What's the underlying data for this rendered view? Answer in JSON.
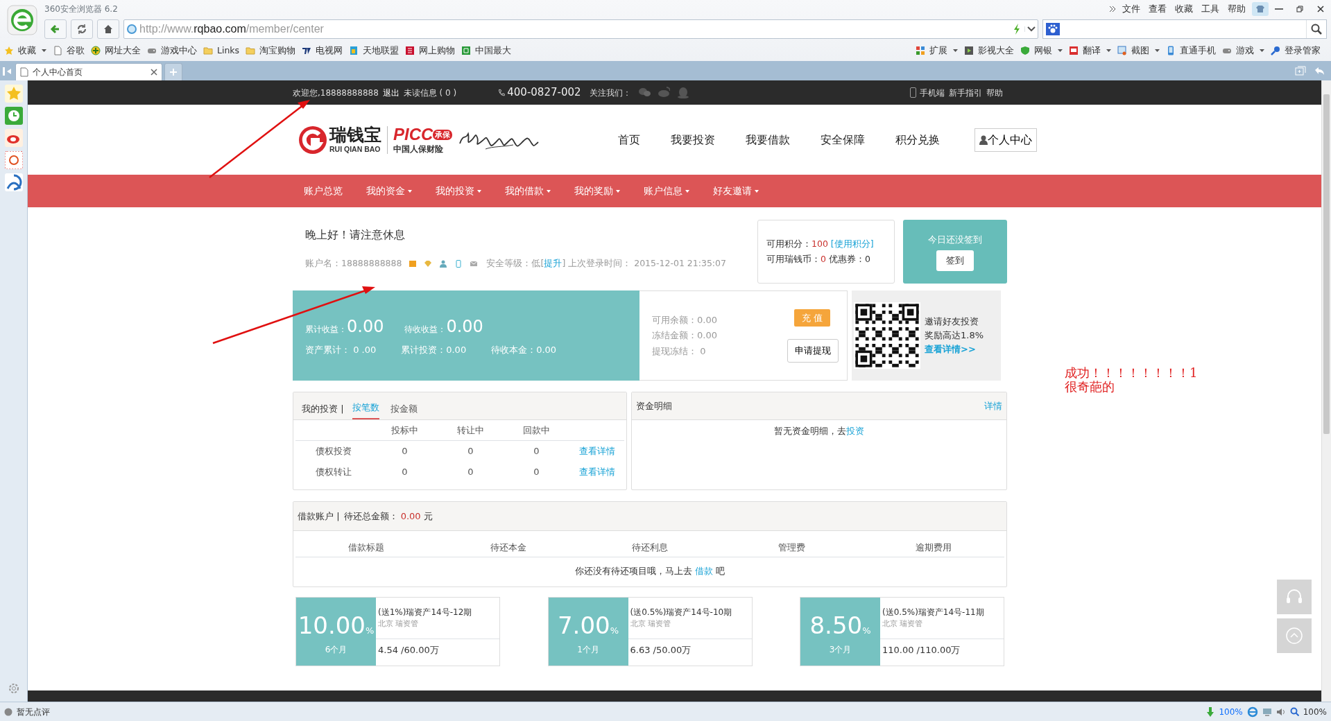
{
  "browser": {
    "title": "360安全浏览器 6.2",
    "menu": [
      "文件",
      "查看",
      "收藏",
      "工具",
      "帮助"
    ],
    "url": {
      "scheme": "http://www.",
      "domain": "rqbao.com",
      "path": "/member/center"
    },
    "bookmarks": [
      {
        "label": "收藏",
        "kind": "star",
        "dropdown": true
      },
      {
        "label": "谷歌",
        "kind": "page",
        "dropdown": false
      },
      {
        "label": "网址大全",
        "kind": "plus",
        "dropdown": false
      },
      {
        "label": "游戏中心",
        "kind": "gamepad",
        "dropdown": false
      },
      {
        "label": "Links",
        "kind": "folder",
        "dropdown": false
      },
      {
        "label": "淘宝购物",
        "kind": "folder",
        "dropdown": false
      },
      {
        "label": "电视网",
        "kind": "tv",
        "dropdown": false
      },
      {
        "label": "天地联盟",
        "kind": "tile",
        "dropdown": false
      },
      {
        "label": "网上购物",
        "kind": "grid",
        "dropdown": false
      },
      {
        "label": "中国最大",
        "kind": "badge",
        "dropdown": false
      }
    ],
    "tools": [
      {
        "label": "扩展",
        "kind": "apps",
        "dropdown": true
      },
      {
        "label": "影视大全",
        "kind": "film",
        "dropdown": false
      },
      {
        "label": "网银",
        "kind": "shield",
        "dropdown": true
      },
      {
        "label": "翻译",
        "kind": "dict",
        "dropdown": true
      },
      {
        "label": "截图",
        "kind": "crop",
        "dropdown": true
      },
      {
        "label": "直通手机",
        "kind": "phone",
        "dropdown": false
      },
      {
        "label": "游戏",
        "kind": "gamepad",
        "dropdown": true
      },
      {
        "label": "登录管家",
        "kind": "key",
        "dropdown": false
      }
    ],
    "tabs": [
      {
        "label": "个人中心首页",
        "selected": true
      }
    ],
    "status_bar": {
      "review": "暂无点评",
      "download": "100%",
      "zoom": "100%"
    }
  },
  "site": {
    "topbar": {
      "welcome": "欢迎您,18888888888",
      "logout": "退出",
      "unread": "未读信息 ( 0 )",
      "phone": "400-0827-002",
      "follow": "关注我们：",
      "links": [
        "手机端",
        "新手指引",
        "帮助"
      ]
    },
    "logo": {
      "name": "瑞钱宝",
      "pinyin": "RUI QIAN BAO",
      "partner": "PICC",
      "badge": "承保",
      "partner_name": "中国人保财险"
    },
    "main_nav": [
      "首页",
      "我要投资",
      "我要借款",
      "安全保障",
      "积分兑换"
    ],
    "user_button": "个人中心",
    "sub_nav": [
      {
        "label": "账户总览",
        "dropdown": false
      },
      {
        "label": "我的资金",
        "dropdown": true
      },
      {
        "label": "我的投资",
        "dropdown": true
      },
      {
        "label": "我的借款",
        "dropdown": true
      },
      {
        "label": "我的奖励",
        "dropdown": true
      },
      {
        "label": "账户信息",
        "dropdown": true
      },
      {
        "label": "好友邀请",
        "dropdown": true
      }
    ],
    "greeting": "晚上好！请注意休息",
    "account": {
      "name": "账户名：18888888888",
      "security_prefix": "安全等级：低[",
      "upgrade": "提升",
      "security_suffix": "] 上次登录时间： 2015-12-01 21:35:07"
    },
    "points": {
      "label": "可用积分：",
      "value": "100",
      "use_link": "[使用积分]",
      "coins_label": "可用瑞钱币：",
      "coins": "0",
      "coupons": "优惠券：0"
    },
    "checkin": {
      "status": "今日还没签到",
      "button": "签到"
    },
    "summary": {
      "income_label": "累计收益：",
      "income": "0.00",
      "pending_label": "待收收益：",
      "pending": "0.00",
      "stats": [
        "资产累计： 0 .00",
        "累计投资：0.00",
        "待收本金：0.00"
      ]
    },
    "balance": {
      "lines": [
        "可用余额：0.00",
        "冻结金额：0.00",
        "提现冻结： 0"
      ],
      "recharge": "充 值",
      "withdraw": "申请提现"
    },
    "invite": {
      "lines": [
        "邀请好友投资",
        "奖励高达1.8%"
      ],
      "link": "查看详情>>"
    },
    "investments": {
      "title": "我的投资 |",
      "tabs": [
        {
          "label": "按笔数",
          "selected": true
        },
        {
          "label": "按金额",
          "selected": false
        }
      ],
      "columns": [
        "投标中",
        "转让中",
        "回款中"
      ],
      "rows": [
        {
          "label": "债权投资",
          "values": [
            "0",
            "0",
            "0"
          ],
          "link": "查看详情"
        },
        {
          "label": "债权转让",
          "values": [
            "0",
            "0",
            "0"
          ],
          "link": "查看详情"
        }
      ]
    },
    "funds": {
      "title": "资金明细",
      "link": "详情",
      "empty": "暂无资金明细，去",
      "empty_link": "投资"
    },
    "loans": {
      "title": "借款账户 |",
      "total_label": "待还总金额：",
      "total": "0.00",
      "unit": "元",
      "columns": [
        "借款标题",
        "待还本金",
        "待还利息",
        "管理费",
        "逾期费用"
      ],
      "empty": "你还没有待还项目哦，马上去 ",
      "empty_link": "借款",
      "empty_suffix": " 吧"
    },
    "products": [
      {
        "rate": "10.00",
        "unit": "%",
        "term": "6个月",
        "title": "(送1%)瑞资产14号-12期",
        "location": "北京 瑞资管",
        "amount": "4.54 /60.00万"
      },
      {
        "rate": "7.00",
        "unit": "%",
        "term": "1个月",
        "title": "(送0.5%)瑞资产14号-10期",
        "location": "北京 瑞资管",
        "amount": "6.63 /50.00万"
      },
      {
        "rate": "8.50",
        "unit": "%",
        "term": "3个月",
        "title": "(送0.5%)瑞资产14号-11期",
        "location": "北京 瑞资管",
        "amount": "110.00 /110.00万"
      }
    ]
  },
  "annotation": {
    "lines": [
      "成功！！！！！！！！1",
      "很奇葩的"
    ]
  }
}
